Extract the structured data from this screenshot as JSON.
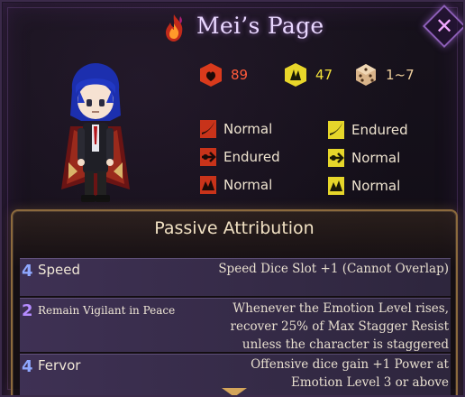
{
  "header": {
    "title": "Mei’s Page",
    "close_label": "✕"
  },
  "stats": {
    "hp": {
      "value": "89",
      "icon": "hp-icon",
      "color": "#ff5a3a"
    },
    "stagger": {
      "value": "47",
      "icon": "stagger-icon",
      "color": "#f3e23a"
    },
    "speed": {
      "value": "1~7",
      "icon": "speed-dice-icon",
      "color": "#efcf9c"
    }
  },
  "resistances": {
    "hp": [
      {
        "type": "slash",
        "label": "Normal"
      },
      {
        "type": "pierce",
        "label": "Endured"
      },
      {
        "type": "blunt",
        "label": "Normal"
      }
    ],
    "stagger": [
      {
        "type": "slash",
        "label": "Endured"
      },
      {
        "type": "pierce",
        "label": "Normal"
      },
      {
        "type": "blunt",
        "label": "Normal"
      }
    ]
  },
  "passive": {
    "title": "Passive Attribution",
    "items": [
      {
        "cost": "4",
        "cost_color": "#8fa8ff",
        "name": "Speed",
        "desc": "Speed Dice Slot +1 (Cannot Overlap)"
      },
      {
        "cost": "2",
        "cost_color": "#b58cff",
        "name": "Remain Vigilant in Peace",
        "desc": "Whenever the Emotion Level rises, recover 25% of Max Stagger Resist unless the character is staggered"
      },
      {
        "cost": "4",
        "cost_color": "#8fa8ff",
        "name": "Fervor",
        "desc": "Offensive dice gain +1 Power at Emotion Level 3 or above"
      }
    ]
  }
}
